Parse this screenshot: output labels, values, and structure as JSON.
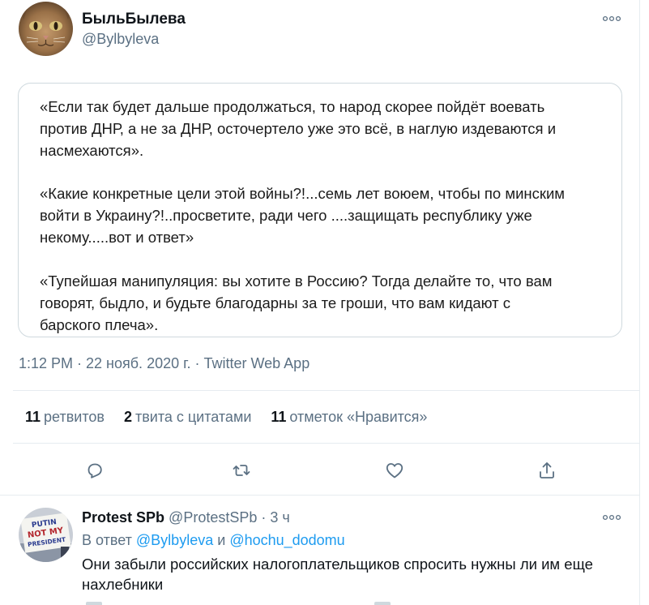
{
  "tweet": {
    "author_name": "БыльБылева",
    "author_handle": "@Bylbyleva",
    "avatar_icon": "cat-face-avatar-icon",
    "quote_paragraphs": [
      [
        "«Если так будет дальше продолжаться, то народ скорее пойдёт воевать",
        "против ДНР, а не за ДНР, осточертело уже это всё, в наглую издеваются и",
        "насмехаются»."
      ],
      [
        "«Какие конкретные цели этой войны?!...семь лет воюем, чтобы по минским",
        "войти в Украину?!..просветите, ради чего ....защищать республику уже",
        "некому.....вот и ответ»"
      ],
      [
        "«Тупейшая манипуляция: вы хотите в Россию? Тогда делайте то, что вам",
        "говорят, быдло, и будьте благодарны за те гроши, что вам кидают с",
        "барского плеча»."
      ]
    ],
    "timestamp": "1:12 PM · 22 нояб. 2020 г. · Twitter Web App",
    "stats": {
      "retweets_count": "11",
      "retweets_label": "ретвитов",
      "quotes_count": "2",
      "quotes_label": "твита с цитатами",
      "likes_count": "11",
      "likes_label": "отметок «Нравится»"
    },
    "actions": [
      "reply-icon",
      "retweet-icon",
      "like-icon",
      "share-icon"
    ]
  },
  "reply": {
    "author_name": "Protest SPb",
    "author_handle": "@ProtestSPb",
    "dot": "·",
    "time": "3 ч",
    "reply_to_prefix": "В ответ",
    "mention_1": "@Bylbyleva",
    "conj": "и",
    "mention_2": "@hochu_dodomu",
    "text": "Они забыли российских налогоплательщиков спросить нужны ли им еще нахлебники",
    "avatar_icon": "protest-sign-avatar-icon",
    "avatar_sign_text": [
      "PUTIN",
      "NOT MY",
      "PRESIDENT"
    ]
  },
  "colors": {
    "accent": "#1d9bf0",
    "secondary_text": "#5b7083",
    "border": "#cfd9de"
  }
}
